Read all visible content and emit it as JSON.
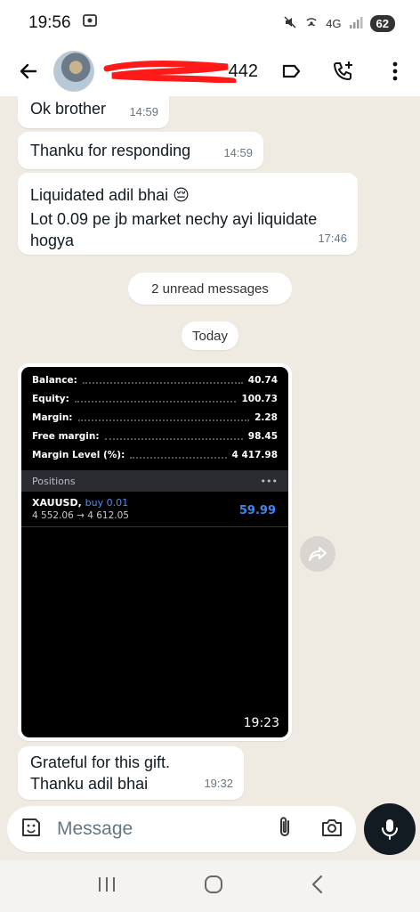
{
  "status_bar": {
    "time": "19:56",
    "network": "4G",
    "battery": "62"
  },
  "header": {
    "contact_suffix": "442"
  },
  "messages": [
    {
      "text": "Ok brother",
      "time": "14:59"
    },
    {
      "text": "Thanku for responding",
      "time": "14:59"
    },
    {
      "text_line1": "Liquidated adil bhai 😔",
      "text_line2": "Lot 0.09 pe jb market nechy ayi liquidate hogya",
      "time": "17:46"
    }
  ],
  "unread_label": "2 unread messages",
  "date_label": "Today",
  "trade_screenshot": {
    "account": [
      {
        "label": "Balance:",
        "value": "40.74"
      },
      {
        "label": "Equity:",
        "value": "100.73"
      },
      {
        "label": "Margin:",
        "value": "2.28"
      },
      {
        "label": "Free margin:",
        "value": "98.45"
      },
      {
        "label": "Margin Level (%):",
        "value": "4 417.98"
      }
    ],
    "positions_label": "Positions",
    "positions_menu": "•••",
    "position": {
      "symbol": "XAUUSD,",
      "side": "buy 0.01",
      "prices": "4 552.06 → 4 612.05",
      "profit": "59.99"
    },
    "time": "19:23"
  },
  "last_message": {
    "line1": "Grateful for this gift.",
    "line2": "Thanku adil bhai",
    "time": "19:32"
  },
  "composer": {
    "placeholder": "Message"
  },
  "colors": {
    "chat_bg": "#efeae2",
    "bubble": "#ffffff",
    "mic_button": "#111b21",
    "profit_blue": "#3f86ee"
  },
  "icons": [
    "back-arrow-icon",
    "label-icon",
    "add-call-icon",
    "more-vert-icon",
    "sticker-icon",
    "attach-icon",
    "camera-icon",
    "mic-icon",
    "forward-icon",
    "recents-icon",
    "home-icon",
    "nav-back-icon"
  ]
}
